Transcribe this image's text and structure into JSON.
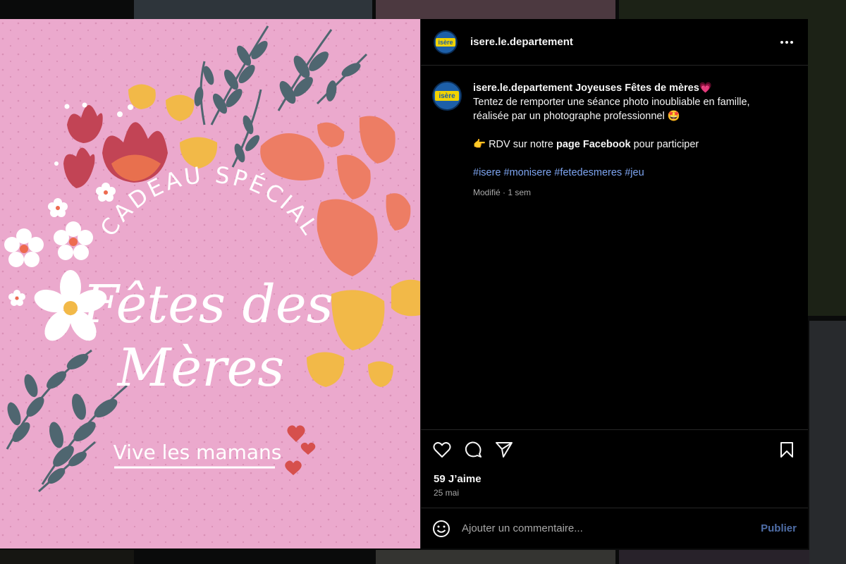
{
  "post": {
    "username": "isere.le.departement",
    "logo_text": "isère",
    "caption": {
      "title": "Joyeuses Fêtes de mères💗",
      "line1": "Tentez de remporter une séance photo inoubliable en famille,",
      "line2": "réalisée par un photographe professionnel 🤩",
      "rdv_prefix": "👉 RDV sur notre ",
      "rdv_bold": "page Facebook",
      "rdv_suffix": " pour participer",
      "hashtags": [
        "#isere",
        "#monisere",
        "#fetedesmeres",
        "#jeu"
      ],
      "meta": "Modifié · 1 sem"
    },
    "image_text": {
      "arc": "CADEAU SPÉCIAL",
      "title1": "Fêtes des",
      "title2": "Mères",
      "subtitle": "Vive les mamans"
    },
    "likes": "59 J’aime",
    "date": "25 mai"
  },
  "icons": {
    "more": "more-dots-icon",
    "like": "heart-icon",
    "comment": "comment-bubble-icon",
    "share": "paper-plane-icon",
    "save": "bookmark-icon",
    "emoji": "emoji-smile-icon"
  },
  "comment": {
    "placeholder": "Ajouter un commentaire...",
    "publish_label": "Publier"
  },
  "colors": {
    "image_background": "#eba9cd",
    "hashtag": "#7ea5f1",
    "publish": "#4f6ea8"
  }
}
